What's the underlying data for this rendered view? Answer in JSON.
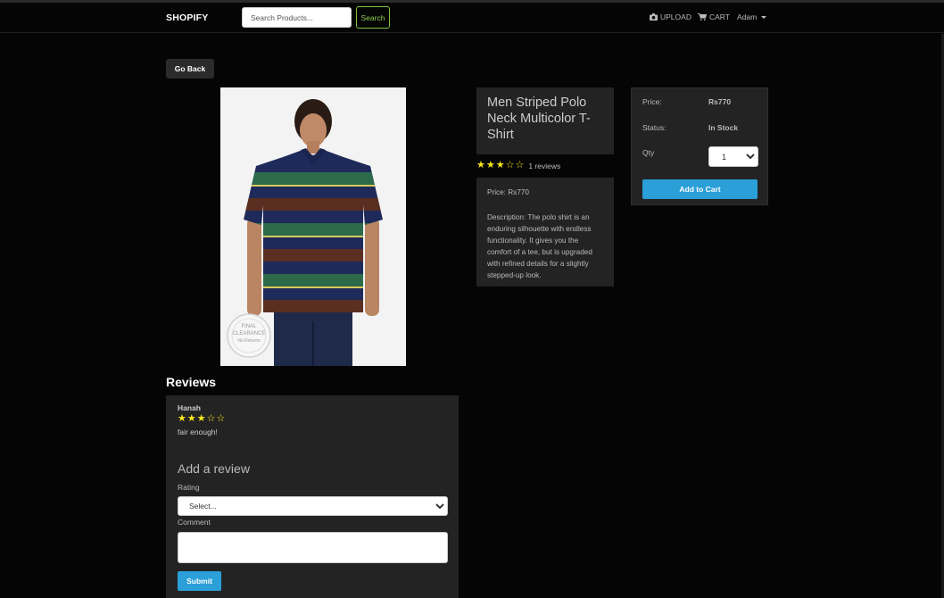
{
  "navbar": {
    "brand": "SHOPIFY",
    "search_placeholder": "Search Products...",
    "search_button": "Search",
    "upload_label": "UPLOAD",
    "upload_icon": "camera-icon",
    "cart_label": "CART",
    "cart_icon": "shopping-cart-icon",
    "user_label": "Adam"
  },
  "go_back_label": "Go Back",
  "product": {
    "image_alt": "Men Striped Polo Neck Multicolor T-Shirt",
    "badge_line1": "FINAL",
    "badge_line2": "CLEARANCE",
    "badge_line3": "No Returns",
    "title": "Men Striped Polo Neck Multicolor T-Shirt",
    "rating": 3,
    "rating_max": 5,
    "reviews_text": "1 reviews",
    "price_line": "Price: Rs770",
    "description": "Description: The polo shirt is an enduring silhouette with endless functionality. It gives you the comfort of a tee, but is upgraded with refined details for a slightly stepped-up look."
  },
  "purchase": {
    "price_label": "Price:",
    "price_value": "Rs770",
    "status_label": "Status:",
    "status_value": "In Stock",
    "qty_label": "Qty",
    "qty_value": "1",
    "add_to_cart": "Add to Cart"
  },
  "reviews": {
    "heading": "Reviews",
    "items": [
      {
        "author": "Hanah",
        "rating": 3,
        "comment": "fair enough!"
      }
    ],
    "form": {
      "title": "Add a review",
      "rating_label": "Rating",
      "rating_placeholder": "Select...",
      "comment_label": "Comment",
      "submit_label": "Submit"
    }
  },
  "colors": {
    "background": "#050505",
    "panel": "#232323",
    "accent_blue": "#2a9fd8",
    "search_green": "#8fd14f",
    "star_yellow": "#f8e71c"
  }
}
